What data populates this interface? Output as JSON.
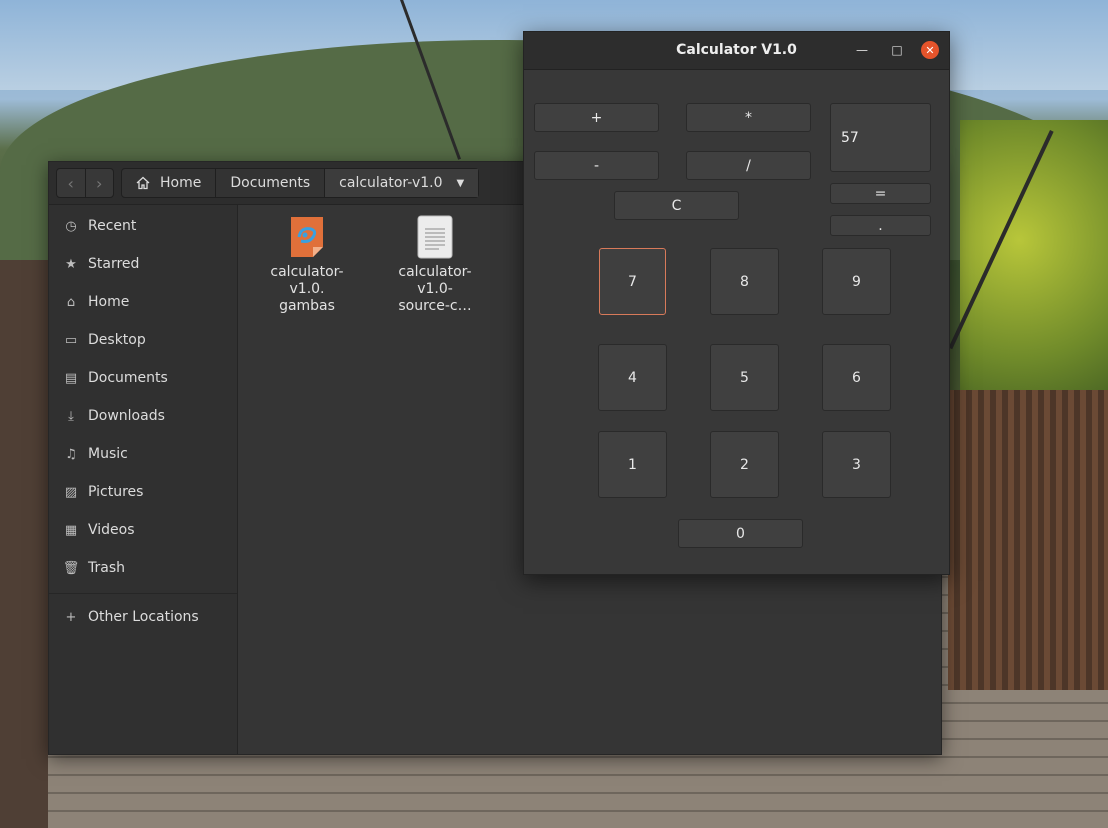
{
  "file_manager": {
    "nav": {
      "back_icon": "chevron-left-icon",
      "forward_icon": "chevron-right-icon"
    },
    "breadcrumbs": [
      "Home",
      "Documents",
      "calculator-v1.0"
    ],
    "sidebar": [
      {
        "label": "Recent",
        "icon": "clock-icon"
      },
      {
        "label": "Starred",
        "icon": "star-icon"
      },
      {
        "label": "Home",
        "icon": "home-icon"
      },
      {
        "label": "Desktop",
        "icon": "desktop-icon"
      },
      {
        "label": "Documents",
        "icon": "document-icon"
      },
      {
        "label": "Downloads",
        "icon": "download-icon"
      },
      {
        "label": "Music",
        "icon": "music-icon"
      },
      {
        "label": "Pictures",
        "icon": "picture-icon"
      },
      {
        "label": "Videos",
        "icon": "video-icon"
      },
      {
        "label": "Trash",
        "icon": "trash-icon"
      },
      {
        "label": "Other Locations",
        "icon": "plus-icon"
      }
    ],
    "files": [
      {
        "line1": "calculator-",
        "line2": "v1.0.",
        "line3": "gambas",
        "icon": "gambas-file-icon"
      },
      {
        "line1": "calculator-",
        "line2": "v1.0-",
        "line3": "source-c…",
        "icon": "text-file-icon"
      }
    ]
  },
  "calculator": {
    "title": "Calculator V1.0",
    "display": "57",
    "buttons": {
      "plus": "+",
      "multiply": "*",
      "minus": "-",
      "divide": "/",
      "clear": "C",
      "equals": "=",
      "dot": ".",
      "d7": "7",
      "d8": "8",
      "d9": "9",
      "d4": "4",
      "d5": "5",
      "d6": "6",
      "d1": "1",
      "d2": "2",
      "d3": "3",
      "d0": "0"
    }
  }
}
